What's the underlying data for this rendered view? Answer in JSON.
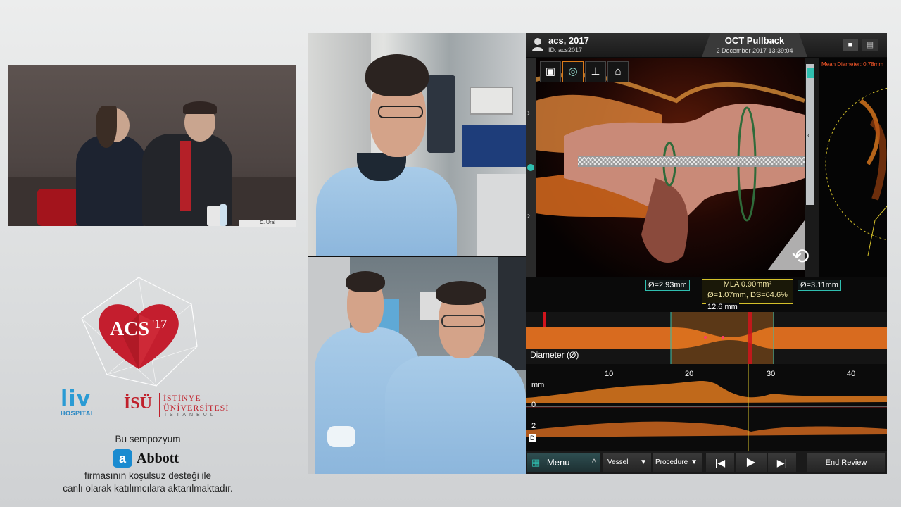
{
  "panel": {
    "nameplate": "C. Ural"
  },
  "branding": {
    "event_logo_main": "ACS",
    "event_logo_year": "'17",
    "liv_name": "liv",
    "liv_sub": "HOSPITAL",
    "isu_short": "İSÜ",
    "isu_line1": "İSTİNYE",
    "isu_line2": "ÜNİVERSİTESİ",
    "isu_city": "İSTANBUL",
    "sponsor_intro": "Bu sempozyum",
    "sponsor_name": "Abbott",
    "sponsor_mark": "a",
    "sponsor_line1": "firmasının koşulsuz desteği ile",
    "sponsor_line2": "canlı olarak katılımcılara aktarılmaktadır."
  },
  "oct": {
    "patient_name": "acs, 2017",
    "patient_id": "ID: acs2017",
    "title": "OCT Pullback",
    "date": "2 December 2017 13:39:04",
    "mean_diameter": "Mean Diameter: 0.78mm",
    "tools": [
      "window-icon",
      "measure-icon",
      "stent-icon",
      "home-icon"
    ],
    "ref_left": "Ø=2.93mm",
    "ref_right": "Ø=3.11mm",
    "mla_line1": "MLA 0.90mm²",
    "mla_line2": "Ø=1.07mm, DS=64.6%",
    "length": "12.6 mm",
    "diameter_label": "Diameter (Ø)",
    "axis_ticks": [
      "10",
      "20",
      "30",
      "40"
    ],
    "mm_label": "mm",
    "zero_label": "0",
    "two_label": "2",
    "d_label": "D",
    "menu_label": "Menu",
    "vessel_label": "Vessel",
    "procedure_label": "Procedure",
    "end_review_label": "End Review"
  },
  "colors": {
    "accent_teal": "#2fbfb0",
    "mla_yellow": "#d4c02a",
    "oct_orange": "#e07a1e",
    "brand_red": "#c0202b",
    "liv_blue": "#2a9bd4"
  }
}
